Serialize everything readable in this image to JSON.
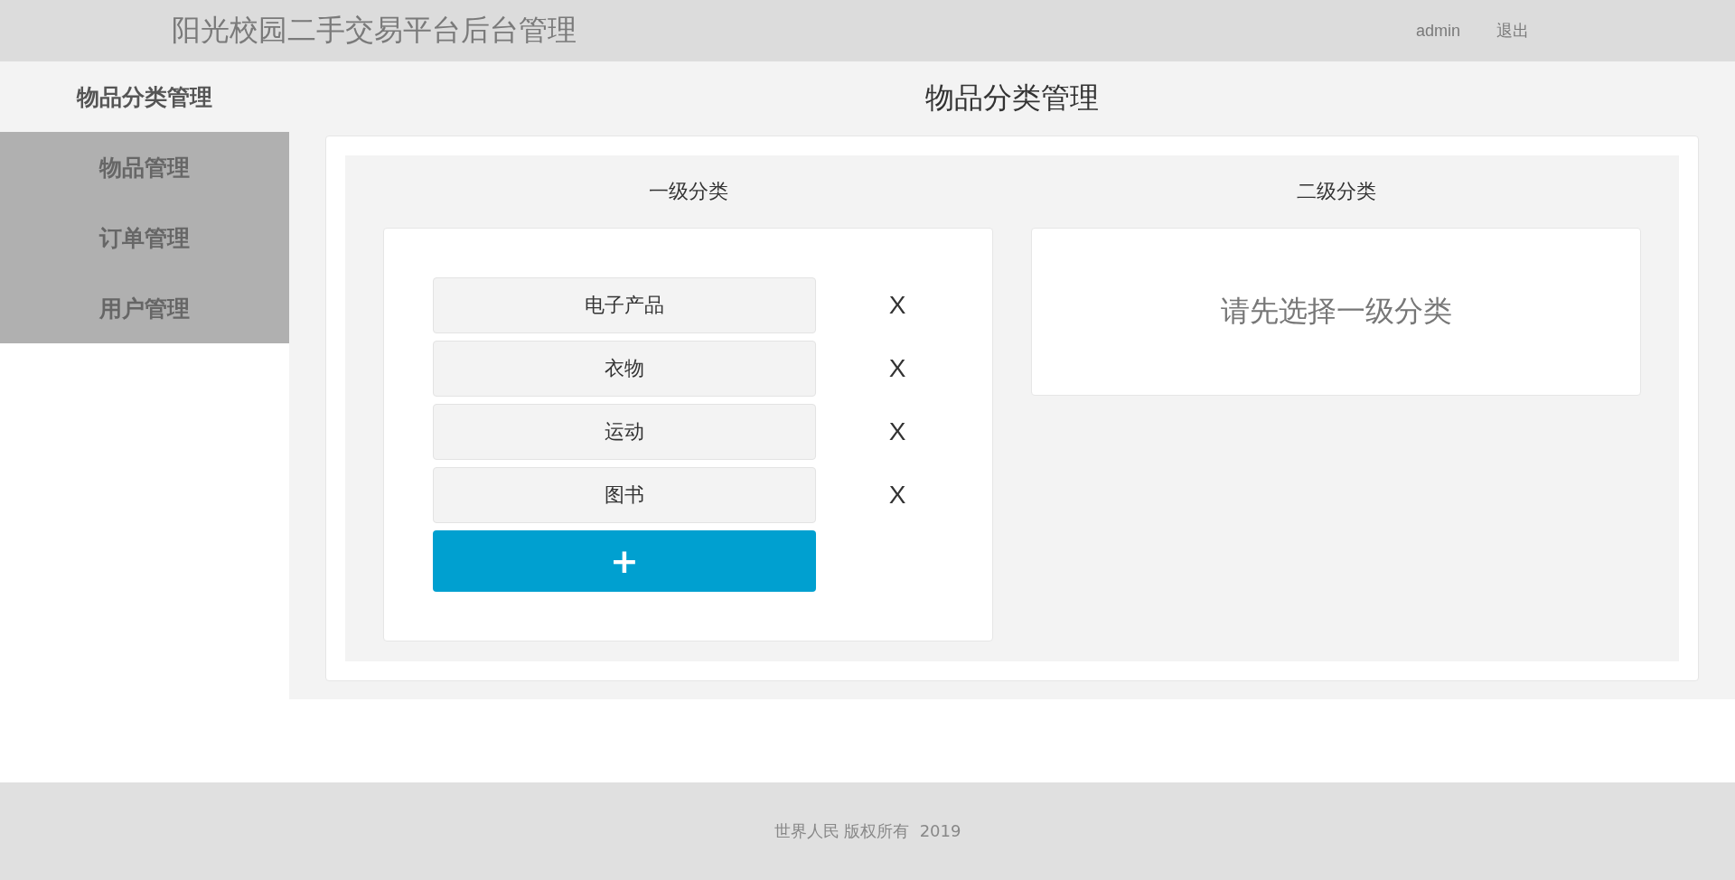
{
  "header": {
    "title": "阳光校园二手交易平台后台管理",
    "user": "admin",
    "logout": "退出"
  },
  "sidebar": {
    "items": [
      {
        "label": "物品分类管理",
        "selected": true
      },
      {
        "label": "物品管理",
        "selected": false
      },
      {
        "label": "订单管理",
        "selected": false
      },
      {
        "label": "用户管理",
        "selected": false
      }
    ]
  },
  "page_title": "物品分类管理",
  "level_one": {
    "heading": "一级分类",
    "categories": [
      {
        "name": "电子产品",
        "delete": "X"
      },
      {
        "name": "衣物",
        "delete": "X"
      },
      {
        "name": "运动",
        "delete": "X"
      },
      {
        "name": "图书",
        "delete": "X"
      }
    ],
    "add_button": "+"
  },
  "level_two": {
    "heading": "二级分类",
    "empty_message": "请先选择一级分类"
  },
  "footer": {
    "text": "世界人民 版权所有  2019"
  }
}
